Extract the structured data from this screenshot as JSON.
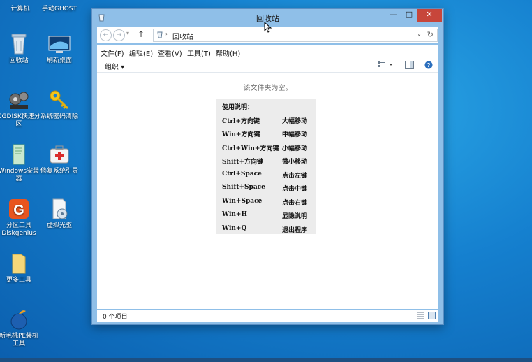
{
  "desktop": {
    "icons": [
      {
        "label": "计算机",
        "icon": "computer-icon"
      },
      {
        "label": "手动GHOST",
        "icon": "ghost-icon"
      },
      {
        "label": "回收站",
        "icon": "recycle-bin-icon"
      },
      {
        "label": "刷新桌面",
        "icon": "monitor-icon"
      },
      {
        "label": "CGDISK快速分区",
        "icon": "gears-icon"
      },
      {
        "label": "系统密码清除",
        "icon": "key-icon"
      },
      {
        "label": "Windows安装器",
        "icon": "installer-icon"
      },
      {
        "label": "修复系统引导",
        "icon": "first-aid-icon"
      },
      {
        "label": "分区工具Diskgenius",
        "icon": "diskgenius-icon"
      },
      {
        "label": "虚拟光驱",
        "icon": "virtual-drive-icon"
      },
      {
        "label": "更多工具",
        "icon": "folder-icon"
      },
      {
        "label": "新毛桃PE装机工具",
        "icon": "peach-icon"
      }
    ]
  },
  "window": {
    "title": "回收站",
    "controls": {
      "minimize": "—",
      "maximize": "□",
      "close": "✕"
    },
    "address": {
      "path": "回收站",
      "back": "←",
      "forward": "→",
      "up": "↑",
      "refresh": "↻"
    },
    "menu": [
      "文件(F)",
      "编辑(E)",
      "查看(V)",
      "工具(T)",
      "帮助(H)"
    ],
    "toolbar": {
      "organize": "组织 ▾"
    },
    "empty_message": "该文件夹为空。",
    "help": {
      "title": "使用说明：",
      "rows": [
        {
          "key": "Ctrl+方向键",
          "action": "大幅移动"
        },
        {
          "key": "Win+方向键",
          "action": "中幅移动"
        },
        {
          "key": "Ctrl+Win+方向键",
          "action": "小幅移动"
        },
        {
          "key": "Shift+方向键",
          "action": "微小移动"
        },
        {
          "key": "Ctrl+Space",
          "action": "点击左键"
        },
        {
          "key": "Shift+Space",
          "action": "点击中键"
        },
        {
          "key": "Win+Space",
          "action": "点击右键"
        },
        {
          "key": "Win+H",
          "action": "显隐说明"
        },
        {
          "key": "Win+Q",
          "action": "退出程序"
        }
      ]
    },
    "status": "0 个项目"
  }
}
